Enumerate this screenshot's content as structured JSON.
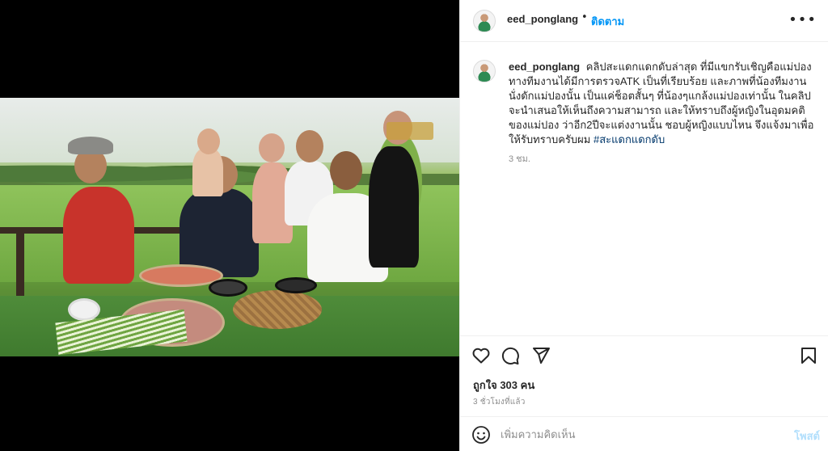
{
  "post": {
    "username": "eed_ponglang",
    "separator": "•",
    "follow_label": "ติดตาม",
    "more_label": "•••",
    "caption_text": "คลิปสะแดกแดกดับล่าสุด ที่มีแขกรับเชิญคือแม่ปอง ทางทีมงานได้มีการตรวจATK เป็นที่เรียบร้อย และภาพที่น้องทีมงาน นั่งดักแม่ปองนั้น เป็นแค่ช็อตสั้นๆ ที่น้องๆแกล้งแม่ปองเท่านั้น ในคลิปจะนำเสนอให้เห็นถึงความสามารถ และให้ทราบถึงผู้หญิงในอุดมคติของแม่ปอง ว่าอีก2ปีจะแต่งงานนั้น ชอบผู้หญิงแบบไหน จึงแจ้งมาเพื่อให้รับทราบครับผม",
    "hashtag": "#สะแดกแดกดับ",
    "caption_time": "3 ชม.",
    "likes": "ถูกใจ 303 คน",
    "posted_ago": "3 ชั่วโมงที่แล้ว",
    "comment_placeholder": "เพิ่มความคิดเห็น",
    "post_label": "โพสต์"
  },
  "icons": {
    "like": "heart-icon",
    "comment": "comment-icon",
    "share": "send-icon",
    "save": "bookmark-icon",
    "emoji": "emoji-icon",
    "more": "more-icon"
  },
  "colors": {
    "accent": "#0095f6",
    "hashtag": "#00376b",
    "post_disabled": "#b2dffc",
    "secondary_text": "#8e8e8e"
  }
}
